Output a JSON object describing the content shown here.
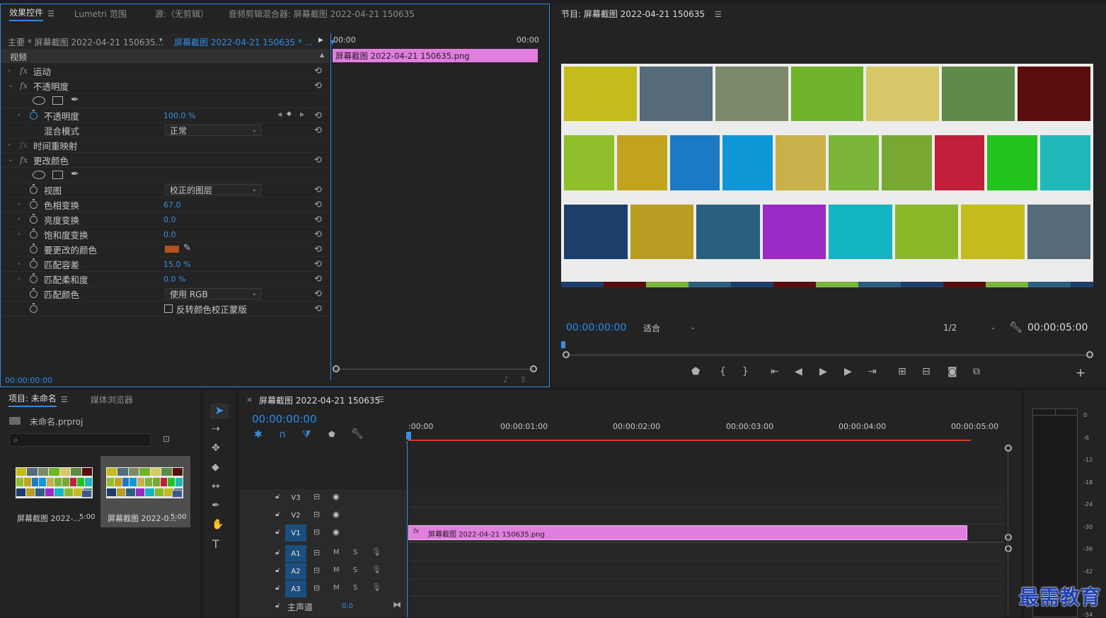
{
  "effect_controls": {
    "tabs": [
      {
        "label": "效果控件",
        "active": true
      },
      {
        "label": "Lumetri 范围",
        "active": false
      },
      {
        "label": "源:（无剪辑）",
        "active": false
      },
      {
        "label": "音频剪辑混合器: 屏幕截图 2022-04-21 150635",
        "active": false
      }
    ],
    "master_label": "主要 * 屏幕截图 2022-04-21 150635...",
    "clip_label": "屏幕截图 2022-04-21 150635 * ...",
    "section_video": "视频",
    "mini_timeline": {
      "start": "00:00",
      "end": "00:00",
      "clip_name": "屏幕截图 2022-04-21  150635.png"
    },
    "rows": {
      "motion": "运动",
      "opacity_group": "不透明度",
      "opacity": "不透明度",
      "opacity_value": "100.0 %",
      "blend_mode": "混合模式",
      "blend_mode_value": "正常",
      "time_remap": "时间重映射",
      "change_color": "更改颜色",
      "view": "视图",
      "view_value": "校正的图层",
      "hue_transform": "色相变换",
      "hue_transform_value": "67.0",
      "lightness_transform": "亮度变换",
      "lightness_transform_value": "0.0",
      "saturation_transform": "饱和度变换",
      "saturation_transform_value": "0.0",
      "color_to_change": "要更改的颜色",
      "match_tolerance": "匹配容差",
      "match_tolerance_value": "15.0 %",
      "match_softness": "匹配柔和度",
      "match_softness_value": "0.0 %",
      "match_colors": "匹配颜色",
      "match_colors_value": "使用 RGB",
      "invert_mask": "反转颜色校正蒙版"
    },
    "timecode": "00:00:00:00",
    "swatch_color": "#b5511f"
  },
  "program": {
    "title": "节目: 屏幕截图 2022-04-21 150635",
    "timecode": "00:00:00:00",
    "fit": "适合",
    "resolution": "1/2",
    "duration": "00:00:05:00"
  },
  "project": {
    "tabs": [
      {
        "label": "项目: 未命名",
        "active": true
      },
      {
        "label": "媒体浏览器",
        "active": false
      }
    ],
    "file": "未命名.prproj",
    "items": [
      {
        "name": "屏幕截图 2022-...",
        "duration": "5:00"
      },
      {
        "name": "屏幕截图 2022-0...",
        "duration": "5:00"
      }
    ]
  },
  "timeline": {
    "title": "屏幕截图 2022-04-21 150635",
    "timecode": "00:00:00:00",
    "ruler": [
      ":00:00",
      "00:00:01:00",
      "00:00:02:00",
      "00:00:03:00",
      "00:00:04:00",
      "00:00:05:00"
    ],
    "video_tracks": [
      "V3",
      "V2",
      "V1"
    ],
    "audio_tracks": [
      "A1",
      "A2",
      "A3"
    ],
    "master": "主声道",
    "master_value": "0.0",
    "clip_name": "屏幕截图 2022-04-21  150635.png",
    "mute": "M",
    "solo": "S"
  },
  "meters": {
    "scale": [
      "0",
      "-6",
      "-12",
      "-18",
      "-24",
      "-30",
      "-36",
      "-42",
      "-54"
    ]
  },
  "watermark": "最需教育",
  "colors": {
    "accent": "#2d8ceb",
    "clip_pink": "#e07fde",
    "playhead_red": "#d9382c"
  }
}
